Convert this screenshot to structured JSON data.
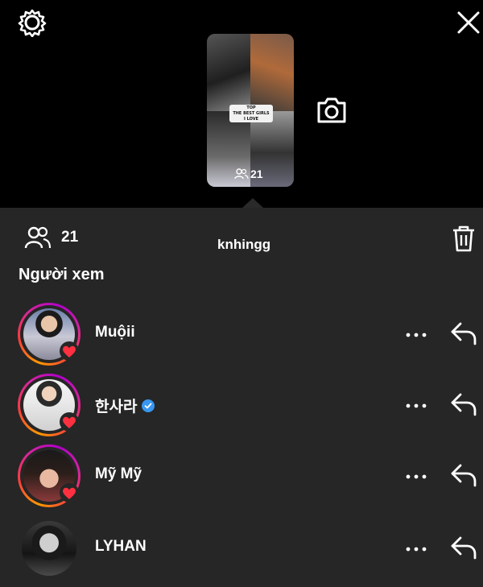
{
  "story": {
    "viewer_count": "21",
    "caption_lines": [
      "TOP",
      "THE BEST GIRLS",
      "I LOVE"
    ]
  },
  "sheet": {
    "viewer_count": "21",
    "username": "knhingg",
    "section_title": "Người xem"
  },
  "viewers": [
    {
      "name": "Muộii",
      "verified": false,
      "liked": true
    },
    {
      "name": "한사라",
      "verified": true,
      "liked": true
    },
    {
      "name": "Mỹ Mỹ",
      "verified": false,
      "liked": true
    },
    {
      "name": "LYHAN",
      "verified": false,
      "liked": false
    }
  ],
  "colors": {
    "background": "#000000",
    "sheet": "#262626",
    "heart": "#ff3040",
    "verified": "#3897f0"
  }
}
